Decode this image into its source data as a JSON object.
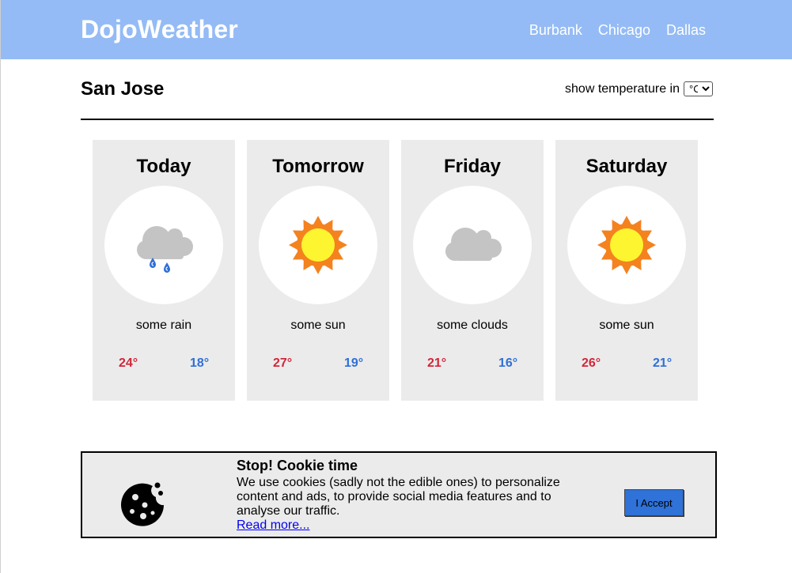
{
  "header": {
    "logo": "DojoWeather",
    "nav": [
      "Burbank",
      "Chicago",
      "Dallas"
    ]
  },
  "location": {
    "city": "San Jose",
    "unit_label": "show temperature in",
    "unit_selected": "°C"
  },
  "forecast": [
    {
      "day": "Today",
      "icon": "rain-cloud-icon",
      "desc": "some rain",
      "high": "24°",
      "low": "18°"
    },
    {
      "day": "Tomorrow",
      "icon": "sun-icon",
      "desc": "some sun",
      "high": "27°",
      "low": "19°"
    },
    {
      "day": "Friday",
      "icon": "cloud-icon",
      "desc": "some clouds",
      "high": "21°",
      "low": "16°"
    },
    {
      "day": "Saturday",
      "icon": "sun-icon",
      "desc": "some sun",
      "high": "26°",
      "low": "21°"
    }
  ],
  "cookie": {
    "icon": "cookie-icon",
    "title": "Stop! Cookie time",
    "text": "We use cookies (sadly not the edible ones) to personalize content and ads, to provide social media features and to analyse our traffic.",
    "link": "Read more...",
    "button": "I Accept"
  },
  "colors": {
    "header_bg": "#94bbf5",
    "card_bg": "#ebebeb",
    "high_temp": "#d1263a",
    "low_temp": "#2f6fd8",
    "accept_button": "#2f72d8"
  }
}
